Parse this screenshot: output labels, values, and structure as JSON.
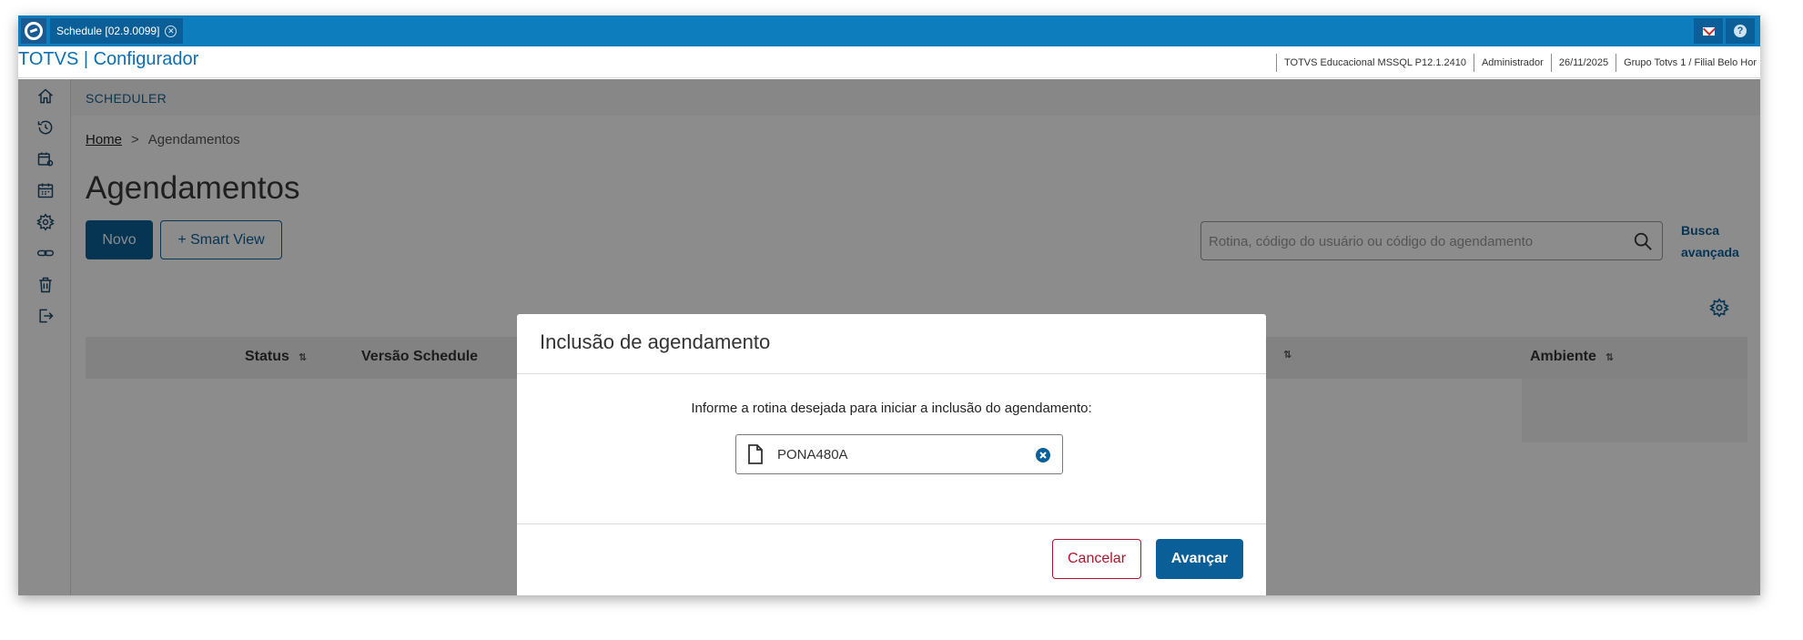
{
  "window": {
    "tab_label": "Schedule [02.9.0099]",
    "brand": "TOTVS | Configurador"
  },
  "statusbar": {
    "items": [
      "TOTVS Educacional MSSQL P12.1.2410",
      "Administrador",
      "26/11/2025",
      "Grupo Totvs 1 / Filial Belo Hor"
    ]
  },
  "sidebar": {
    "icons": [
      "home-icon",
      "history-icon",
      "calendar-settings-icon",
      "calendar-icon",
      "gear-icon",
      "link-icon",
      "trash-icon",
      "logout-icon"
    ]
  },
  "page": {
    "section": "SCHEDULER",
    "breadcrumb": {
      "home": "Home",
      "separator": ">",
      "current": "Agendamentos"
    },
    "title": "Agendamentos",
    "buttons": {
      "novo": "Novo",
      "smart_view": "+ Smart View"
    },
    "search": {
      "placeholder": "Rotina, código do usuário ou código do agendamento",
      "advanced_line1": "Busca",
      "advanced_line2": "avançada"
    }
  },
  "table": {
    "columns": [
      {
        "label": "Status",
        "sort": "⇅"
      },
      {
        "label": "Versão Schedule"
      },
      {
        "label": "Ambiente",
        "sort": "⇅"
      }
    ],
    "partial_sort_icon": "⇅"
  },
  "modal": {
    "title": "Inclusão de agendamento",
    "message": "Informe a rotina desejada para iniciar a inclusão do agendamento:",
    "routine_value": "PONA480A",
    "cancel": "Cancelar",
    "next": "Avançar"
  },
  "colors": {
    "topbar": "#0e7dbd",
    "primary": "#0b5f98",
    "danger": "#b0132b",
    "overlay": "rgba(0,0,0,0.45)"
  }
}
